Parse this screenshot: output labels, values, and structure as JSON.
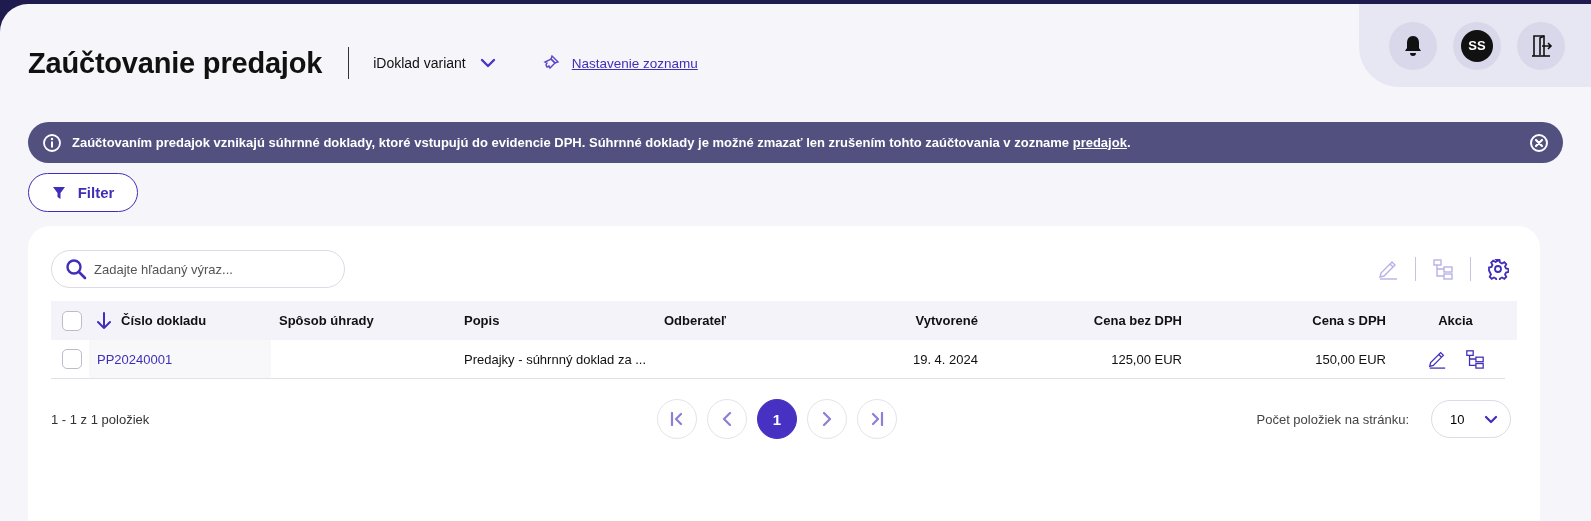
{
  "header": {
    "title": "Zaúčtovanie predajok",
    "variant": "iDoklad variant",
    "settings_link": "Nastavenie zoznamu"
  },
  "user": {
    "initials": "SS"
  },
  "banner": {
    "text_before": "Zaúčtovaním predajok vznikajú súhrnné doklady, ktoré vstupujú do evidencie DPH. Súhrnné doklady je možné zmazať len zrušením tohto zaúčtovania v zozname ",
    "link": "predajok",
    "text_after": "."
  },
  "filter_button": "Filter",
  "search": {
    "placeholder": "Zadajte hľadaný výraz..."
  },
  "toolbar": [
    {
      "kind": "edit",
      "disabled": true
    },
    {
      "kind": "tree",
      "disabled": true
    },
    {
      "kind": "settings",
      "disabled": false
    }
  ],
  "table": {
    "select_all": {
      "checked": false
    },
    "columns": [
      {
        "label": "Číslo dokladu",
        "sorted": true
      },
      {
        "label": "Spôsob úhrady",
        "sorted": false
      },
      {
        "label": "Popis",
        "sorted": false
      },
      {
        "label": "Odberateľ",
        "sorted": false
      },
      {
        "label": "Vytvorené",
        "sorted": false
      },
      {
        "label": "Cena bez DPH",
        "sorted": false
      },
      {
        "label": "Cena s DPH",
        "sorted": false
      },
      {
        "label": "Akcia",
        "sorted": false
      }
    ],
    "rows": [
      {
        "checked": false,
        "number": "PP20240001",
        "description": "Predajky - súhrnný doklad za ...",
        "created": "19. 4. 2024",
        "price_net": "125,00 EUR",
        "price_gross": "150,00 EUR"
      }
    ]
  },
  "footer": {
    "count": "1 - 1 z 1 položiek",
    "pages": [
      {
        "label": "1",
        "selected": true
      }
    ],
    "per_page_label": "Počet položiek na stránku:",
    "per_page_value": "10"
  }
}
